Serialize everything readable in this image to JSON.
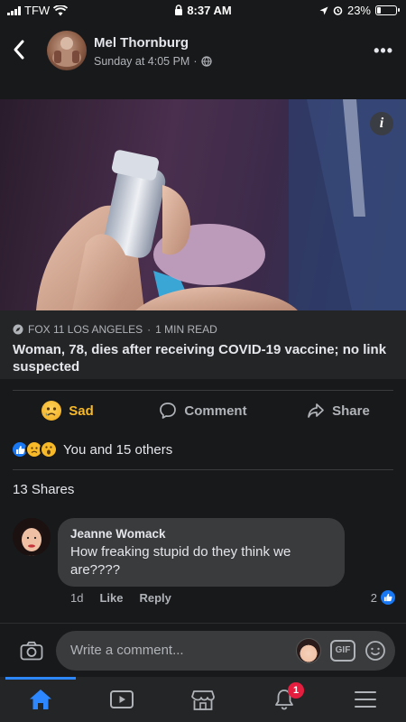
{
  "status_bar": {
    "carrier": "TFW",
    "time": "8:37 AM",
    "battery_percent": "23%",
    "battery_level": 0.23
  },
  "post": {
    "author": "Mel Thornburg",
    "timestamp": "Sunday at 4:05 PM",
    "privacy_icon": "globe-icon",
    "link_preview": {
      "source": "FOX 11 LOS ANGELES",
      "read_time": "1 MIN READ",
      "headline": "Woman, 78, dies after receiving COVID-19 vaccine; no link suspected"
    },
    "actions": {
      "reaction_label": "Sad",
      "comment_label": "Comment",
      "share_label": "Share"
    },
    "reactions_summary": "You and 15 others",
    "shares": "13 Shares"
  },
  "comment": {
    "author": "Jeanne Womack",
    "text": "How freaking stupid do they think we are????",
    "age": "1d",
    "like_label": "Like",
    "reply_label": "Reply",
    "like_count": "2"
  },
  "composer": {
    "placeholder": "Write a comment...",
    "gif_label": "GIF"
  },
  "tab_bar": {
    "tabs": [
      "home",
      "watch",
      "marketplace",
      "notifications",
      "menu"
    ],
    "notifications_badge": "1"
  },
  "colors": {
    "background": "#18191a",
    "accent": "#2d88ff",
    "sad_reaction": "#f7b928",
    "badge": "#e41e3f"
  }
}
